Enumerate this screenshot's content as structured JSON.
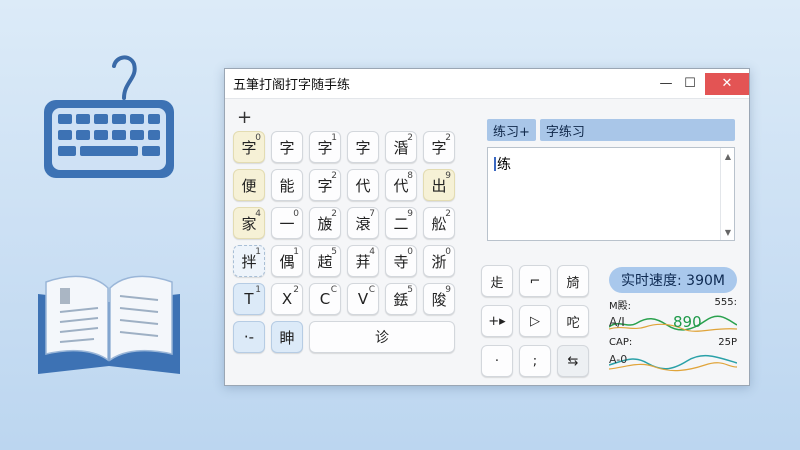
{
  "window": {
    "title": "五筆打阁打字随手练",
    "minimize": "—",
    "maximize": "☐",
    "close": "✕"
  },
  "plus": "+",
  "keys": [
    [
      {
        "char": "字",
        "sup": "0",
        "style": "yellow"
      },
      {
        "char": "字",
        "sup": "",
        "style": ""
      },
      {
        "char": "字",
        "sup": "1",
        "style": ""
      },
      {
        "char": "字",
        "sup": "",
        "style": ""
      },
      {
        "char": "涽",
        "sup": "2",
        "style": ""
      },
      {
        "char": "字",
        "sup": "2",
        "style": ""
      }
    ],
    [
      {
        "char": "便",
        "sup": "",
        "style": "yellow"
      },
      {
        "char": "能",
        "sup": "",
        "style": ""
      },
      {
        "char": "字",
        "sup": "2",
        "style": ""
      },
      {
        "char": "代",
        "sup": "",
        "style": ""
      },
      {
        "char": "代",
        "sup": "8",
        "style": ""
      },
      {
        "char": "出",
        "sup": "9",
        "style": "yellow"
      }
    ],
    [
      {
        "char": "家",
        "sup": "4",
        "style": "yellow"
      },
      {
        "char": "一",
        "sup": "0",
        "style": ""
      },
      {
        "char": "旇",
        "sup": "2",
        "style": ""
      },
      {
        "char": "滖",
        "sup": "7",
        "style": ""
      },
      {
        "char": "二",
        "sup": "9",
        "style": ""
      },
      {
        "char": "舩",
        "sup": "2",
        "style": ""
      }
    ],
    [
      {
        "char": "拌",
        "sup": "1",
        "style": "dashed"
      },
      {
        "char": "偶",
        "sup": "1",
        "style": ""
      },
      {
        "char": "趤",
        "sup": "5",
        "style": ""
      },
      {
        "char": "荓",
        "sup": "4",
        "style": ""
      },
      {
        "char": "寺",
        "sup": "0",
        "style": ""
      },
      {
        "char": "浙",
        "sup": "0",
        "style": ""
      }
    ],
    [
      {
        "char": "T",
        "sup": "1",
        "style": "blue"
      },
      {
        "char": "X",
        "sup": "2",
        "style": ""
      },
      {
        "char": "C",
        "sup": "C",
        "style": ""
      },
      {
        "char": "V",
        "sup": "C",
        "style": ""
      },
      {
        "char": "銩",
        "sup": "5",
        "style": ""
      },
      {
        "char": "陖",
        "sup": "9",
        "style": ""
      }
    ]
  ],
  "bottom_row": {
    "key1": "·-",
    "key2": "眒",
    "space": "诊"
  },
  "tabs": {
    "tab1": "练习+",
    "tab2": "字练习"
  },
  "textbox": {
    "text": "练"
  },
  "scrollbar": {
    "up": "▲",
    "down": "▼"
  },
  "tool_keys": [
    [
      "歨",
      "⌐",
      "旑"
    ],
    [
      "+▸",
      "▷",
      "咜"
    ],
    [
      "·",
      ";",
      "⇆"
    ]
  ],
  "stats": {
    "speed_label": "实时速度: 390M",
    "stat1_label": "M殿:",
    "stat1_right": "555:",
    "stat1_value": "890",
    "stat1_sublabel": "A/I",
    "stat2_label": "CAP:",
    "stat2_right": "25P",
    "stat2_sublabel": "A-0"
  },
  "colors": {
    "accent": "#a9c6e8",
    "close": "#e35454",
    "key_yellow": "#f6f1d6",
    "graph_green": "#1f9a4a",
    "graph_teal": "#2aa1a8",
    "graph_orange": "#e0a43a"
  }
}
